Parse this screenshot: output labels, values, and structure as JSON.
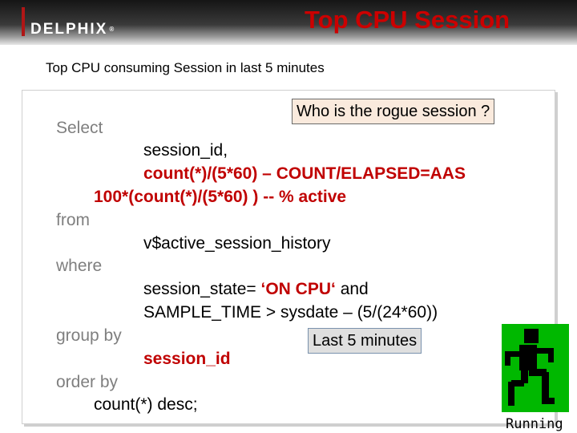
{
  "header": {
    "logo_text": "DELPHIX",
    "title": "Top CPU Session"
  },
  "subtitle": "Top CPU consuming Session in last 5 minutes",
  "code": {
    "select_kw": "Select",
    "col1": "session_id,",
    "col2": "count(*)/(5*60) – COUNT/ELAPSED=AAS",
    "col3": "100*(count(*)/(5*60) )  -- % active",
    "from_kw": "from",
    "table": "v$active_session_history",
    "where_kw": "where",
    "cond1_prefix": "session_state= ",
    "cond1_value": "‘ON CPU‘",
    "cond1_suffix": " and",
    "cond2": "SAMPLE_TIME > sysdate – (5/(24*60))",
    "group_kw": "group by",
    "group_col": "session_id",
    "order_kw": "order by",
    "order_expr": "count(*) desc;"
  },
  "callouts": {
    "rogue": "Who is the rogue session ?",
    "last5": "Last 5 minutes"
  },
  "running_icon": {
    "label": "Running",
    "color": "#00b800"
  },
  "colors": {
    "title_red": "#cc0000",
    "keyword_grey": "#7f7f7f",
    "highlight_red": "#c00000"
  }
}
